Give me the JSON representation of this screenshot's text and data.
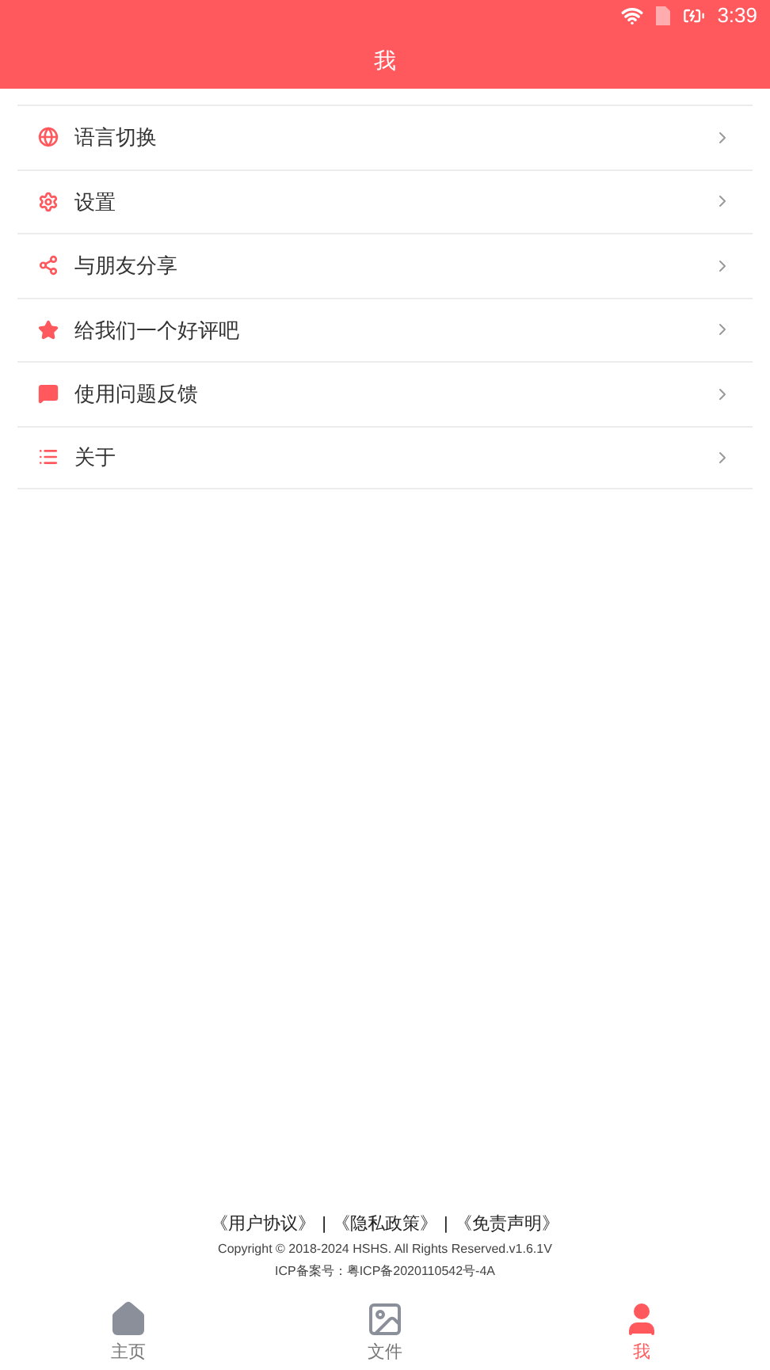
{
  "status_bar": {
    "time": "3:39"
  },
  "header": {
    "title": "我"
  },
  "menu": [
    {
      "kind": "globe",
      "label": "语言切换"
    },
    {
      "kind": "settings",
      "label": "设置"
    },
    {
      "kind": "share",
      "label": "与朋友分享"
    },
    {
      "kind": "star",
      "label": "给我们一个好评吧"
    },
    {
      "kind": "feedback",
      "label": "使用问题反馈"
    },
    {
      "kind": "list",
      "label": "关于"
    }
  ],
  "footer": {
    "links": [
      "《用户协议》",
      "《隐私政策》",
      "《免责声明》"
    ],
    "separator": "|",
    "copyright": "Copyright © 2018-2024 HSHS. All Rights Reserved.v1.6.1V",
    "icp": "ICP备案号：粤ICP备2020110542号-4A"
  },
  "tabs": [
    {
      "kind": "home",
      "label": "主页",
      "selected": false
    },
    {
      "kind": "files",
      "label": "文件",
      "selected": false
    },
    {
      "kind": "profile",
      "label": "我",
      "selected": true
    }
  ]
}
